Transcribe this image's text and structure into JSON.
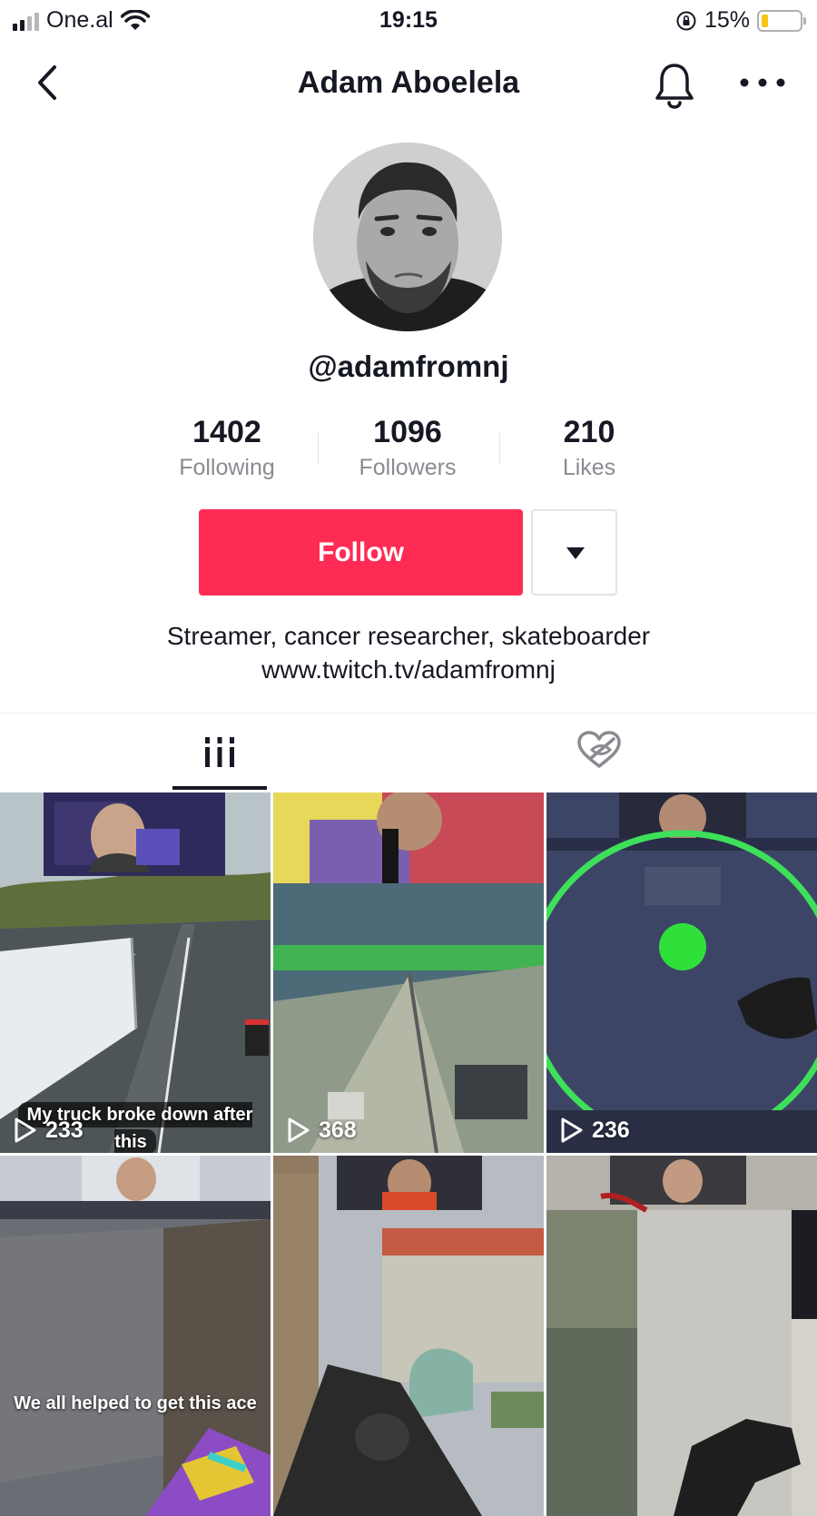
{
  "status_bar": {
    "carrier": "One.al",
    "time": "19:15",
    "battery_percent": "15%",
    "signal_bars_active": 2,
    "battery_level": 0.15
  },
  "header": {
    "title": "Adam Aboelela",
    "icons": [
      "back-chevron-icon",
      "bell-icon",
      "more-icon"
    ]
  },
  "profile": {
    "handle": "@adamfromnj",
    "stats": [
      {
        "value": "1402",
        "label": "Following"
      },
      {
        "value": "1096",
        "label": "Followers"
      },
      {
        "value": "210",
        "label": "Likes"
      }
    ],
    "follow_label": "Follow",
    "bio_lines": [
      "Streamer, cancer researcher, skateboarder",
      "www.twitch.tv/adamfromnj"
    ]
  },
  "tabs": [
    {
      "icon": "videos-grid-icon",
      "active": true
    },
    {
      "icon": "liked-hidden-icon",
      "active": false
    }
  ],
  "videos": [
    {
      "views": "233",
      "caption": "My truck broke down after this"
    },
    {
      "views": "368",
      "caption": ""
    },
    {
      "views": "236",
      "caption": ""
    },
    {
      "views": "",
      "caption": "We all helped to get this ace"
    },
    {
      "views": "",
      "caption": ""
    },
    {
      "views": "",
      "caption": ""
    }
  ],
  "colors": {
    "accent": "#fe2c55",
    "text": "#161823",
    "muted": "#8a8b91"
  }
}
